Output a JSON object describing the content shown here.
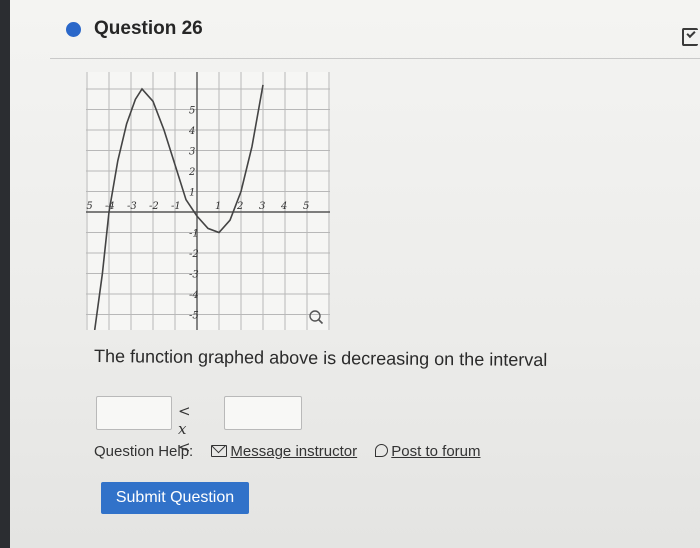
{
  "question": {
    "title": "Question 26",
    "prompt": "The function graphed above is decreasing on the interval",
    "inequality": "< x <",
    "answer_left_value": "",
    "answer_right_value": ""
  },
  "graph": {
    "x_ticks": [
      "-5",
      "-4",
      "-3",
      "-2",
      "-1",
      "1",
      "2",
      "3",
      "4",
      "5"
    ],
    "y_ticks": [
      "5",
      "4",
      "3",
      "2",
      "1",
      "-1",
      "-2",
      "-3",
      "-4",
      "-5"
    ],
    "curve_points": [
      [
        -4.65,
        -6
      ],
      [
        -4.3,
        -3
      ],
      [
        -4,
        0
      ],
      [
        -3.6,
        2.5
      ],
      [
        -3.2,
        4.3
      ],
      [
        -2.8,
        5.5
      ],
      [
        -2.5,
        6
      ],
      [
        -2,
        5.4
      ],
      [
        -1.5,
        4
      ],
      [
        -1,
        2.3
      ],
      [
        -0.5,
        0.6
      ],
      [
        0,
        -0.2
      ],
      [
        0.5,
        -0.8
      ],
      [
        1,
        -1
      ],
      [
        1.5,
        -0.4
      ],
      [
        2,
        1
      ],
      [
        2.5,
        3.2
      ],
      [
        3,
        6.2
      ]
    ],
    "zoom_icon": "magnifier-icon"
  },
  "help": {
    "label": "Question Help:",
    "message_link": "Message instructor",
    "forum_link": "Post to forum"
  },
  "submit_label": "Submit Question",
  "accent_color": "#3172c9"
}
